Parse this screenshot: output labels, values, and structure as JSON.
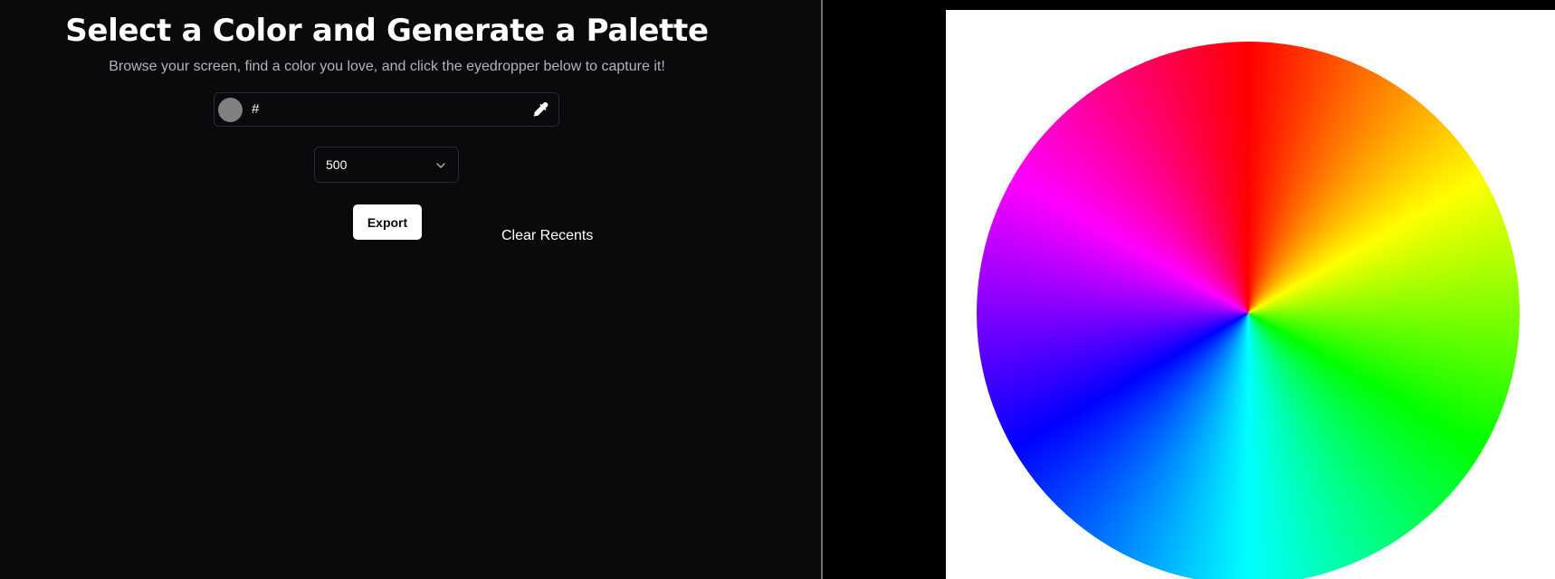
{
  "header": {
    "title": "Select a Color and Generate a Palette",
    "subtitle": "Browse your screen, find a color you love, and click the eyedropper below to capture it!"
  },
  "color_input": {
    "hash_symbol": "#",
    "value": "",
    "placeholder": "",
    "swatch_color": "#808080",
    "eyedropper_icon": "eyedropper-icon"
  },
  "shade_select": {
    "selected": "500",
    "chevron_icon": "chevron-down-icon"
  },
  "actions": {
    "export_label": "Export",
    "clear_recents_label": "Clear Recents"
  },
  "colors": {
    "left_panel_bg": "#0a0a0c",
    "right_panel_bg": "#000000",
    "wheel_bg": "#ffffff",
    "accent_button": "#ffffff"
  }
}
